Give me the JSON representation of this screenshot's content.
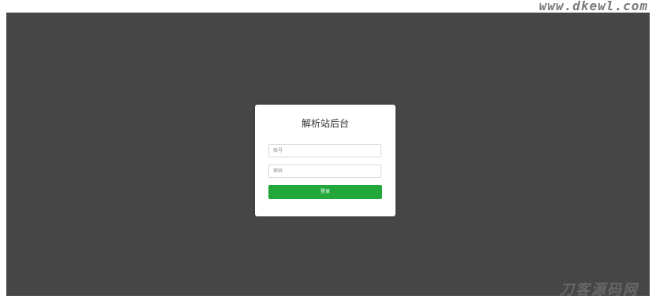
{
  "watermark": {
    "url": "www.dkewl.com",
    "bottom_text": "刀客源码网"
  },
  "login": {
    "title": "解析站后台",
    "account_placeholder": "账号",
    "password_placeholder": "密码",
    "submit_label": "登录"
  },
  "colors": {
    "background": "#464646",
    "card": "#ffffff",
    "button": "#23a73b"
  }
}
